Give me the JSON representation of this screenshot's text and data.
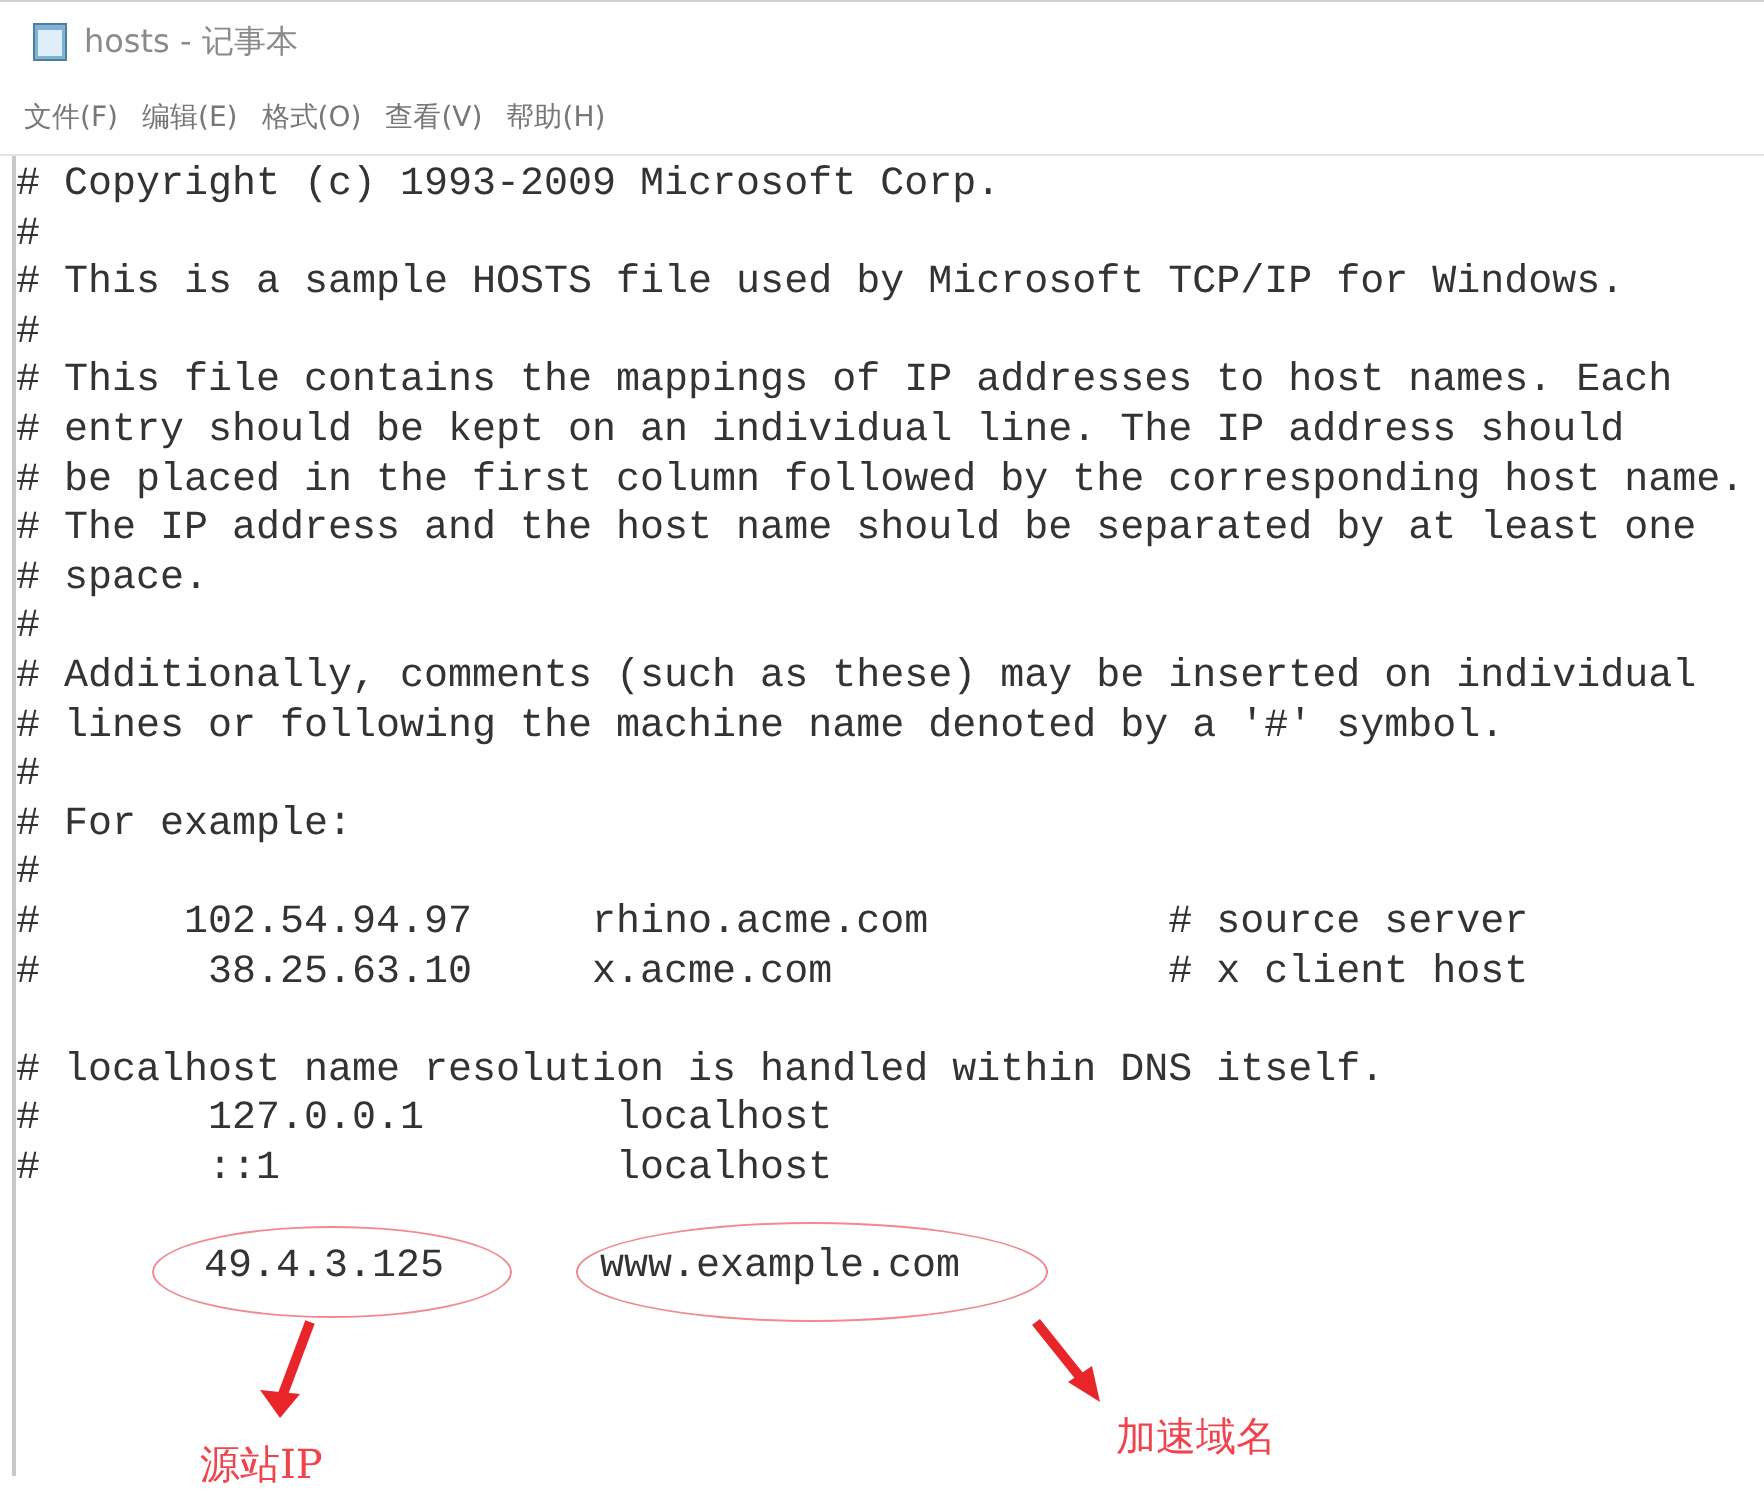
{
  "window": {
    "title": "hosts - 记事本"
  },
  "menu": [
    "文件(F)",
    "编辑(E)",
    "格式(O)",
    "查看(V)",
    "帮助(H)"
  ],
  "editor": {
    "lines": [
      {
        "text": "# Copyright (c) 1993-2009 Microsoft Corp."
      },
      {
        "text": "#"
      },
      {
        "text": "# This is a sample HOSTS file used by Microsoft TCP/IP for Windows."
      },
      {
        "text": "#"
      },
      {
        "text": "# This file contains the mappings of IP addresses to host names. Each"
      },
      {
        "text": "# entry should be kept on an individual line. The IP address should"
      },
      {
        "text": "# be placed in the first column followed by the corresponding host name."
      },
      {
        "text": "# The IP address and the host name should be separated by at least one"
      },
      {
        "text": "# space."
      },
      {
        "text": "#"
      },
      {
        "text": "# Additionally, comments (such as these) may be inserted on individual"
      },
      {
        "text": "# lines or following the machine name denoted by a '#' symbol."
      },
      {
        "text": "#"
      },
      {
        "text": "# For example:"
      },
      {
        "text": "#"
      },
      {
        "text": "#      102.54.94.97     rhino.acme.com          # source server"
      },
      {
        "text": "#       38.25.63.10     x.acme.com              # x client host"
      },
      {
        "text": "# localhost name resolution is handled within DNS itself.",
        "blank_before": true
      },
      {
        "text": "#       127.0.0.1        localhost"
      },
      {
        "text": "#       ::1              localhost"
      }
    ],
    "entry": {
      "ip": "49.4.3.125",
      "host": "www.example.com"
    }
  },
  "annotations": [
    {
      "label": "源站IP"
    },
    {
      "label": "加速域名"
    }
  ]
}
